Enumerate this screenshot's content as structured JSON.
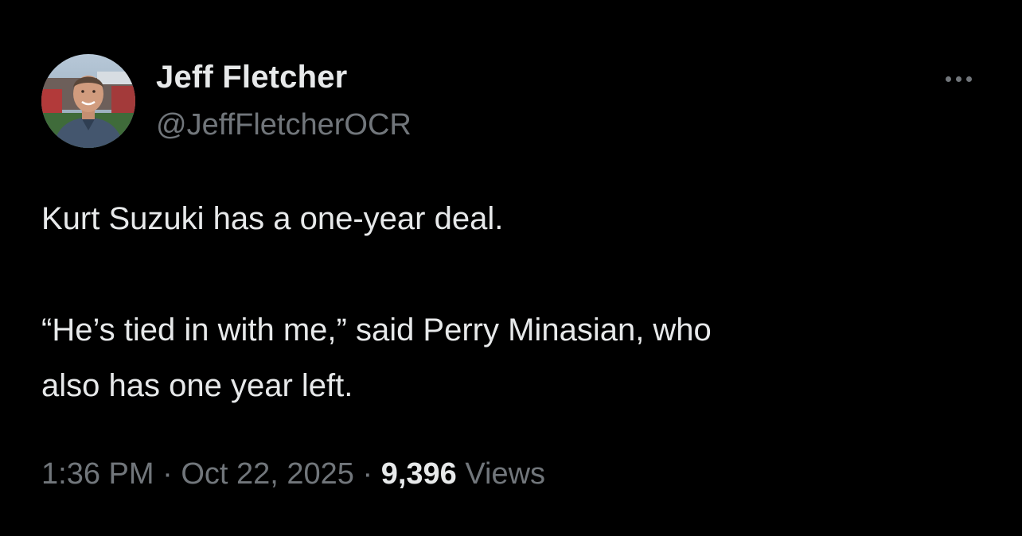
{
  "author": {
    "display_name": "Jeff Fletcher",
    "handle": "@JeffFletcherOCR",
    "avatar_icon": "profile-photo"
  },
  "more_icon": "more-horizontal-icon",
  "tweet": {
    "line1": "Kurt Suzuki has a one-year deal.",
    "line2": "“He’s tied in with me,” said Perry Minasian, who",
    "line3": "also has one year left."
  },
  "meta": {
    "time": "1:36 PM",
    "separator": "·",
    "date": "Oct 22, 2025",
    "views_count": "9,396",
    "views_label": "Views"
  },
  "colors": {
    "background": "#000000",
    "primary_text": "#e7e9ea",
    "secondary_text": "#71767b"
  }
}
